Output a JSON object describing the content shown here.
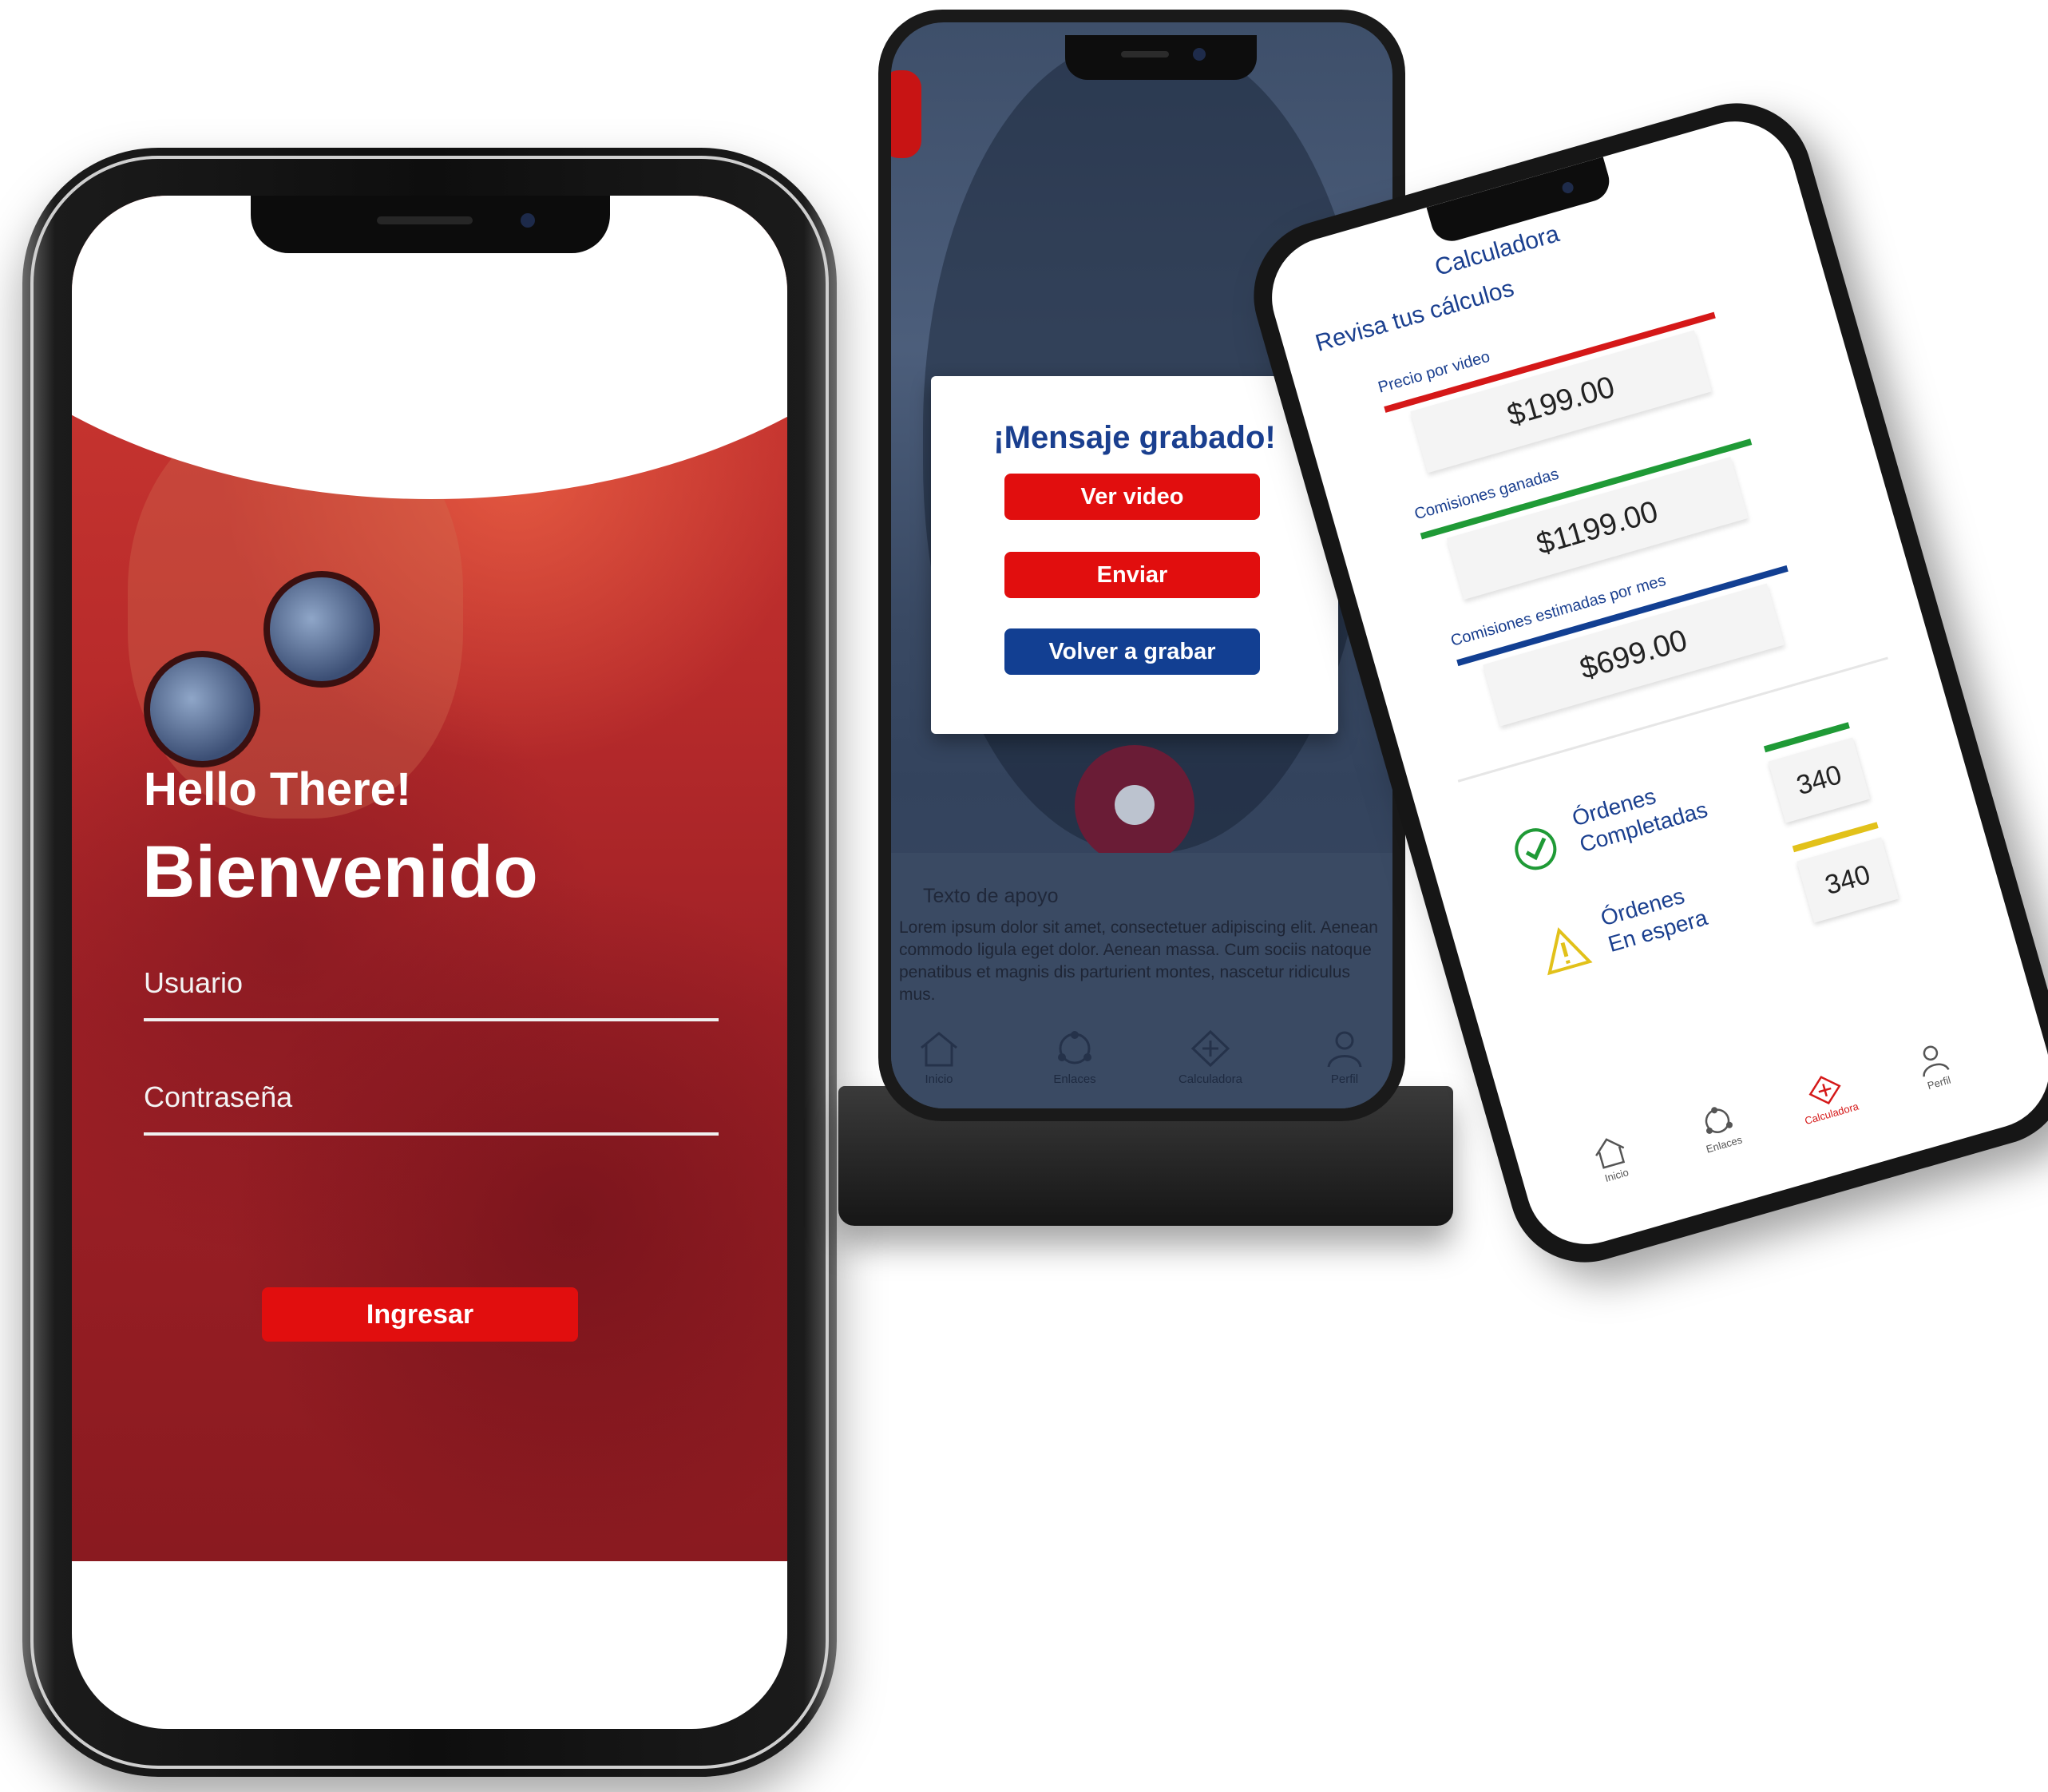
{
  "login": {
    "greeting": "Hello There!",
    "title": "Bienvenido",
    "user_label": "Usuario",
    "password_label": "Contraseña",
    "submit": "Ingresar"
  },
  "video": {
    "modal_title": "¡Mensaje grabado!",
    "btn_view": "Ver video",
    "btn_send": "Enviar",
    "btn_rerecord": "Volver a grabar",
    "support_title": "Texto de apoyo",
    "support_text": "Lorem ipsum dolor sit amet, consectetuer adipiscing elit. Aenean commodo ligula eget dolor. Aenean massa. Cum sociis natoque penatibus et magnis dis parturient montes, nascetur ridiculus mus.",
    "nav": [
      {
        "label": "Inicio",
        "icon": "home-icon"
      },
      {
        "label": "Enlaces",
        "icon": "network-icon"
      },
      {
        "label": "Calculadora",
        "icon": "calculator-icon"
      },
      {
        "label": "Perfil",
        "icon": "user-icon"
      }
    ]
  },
  "calc": {
    "header": "Calculadora",
    "subtitle": "Revisa tus cálculos",
    "cards": [
      {
        "label": "Precio por video",
        "value": "$199.00",
        "color": "#d51818"
      },
      {
        "label": "Comisiones ganadas",
        "value": "$1199.00",
        "color": "#1f9a36"
      },
      {
        "label": "Comisiones estimadas por mes",
        "value": "$699.00",
        "color": "#123f92"
      }
    ],
    "orders": [
      {
        "label_line1": "Órdenes",
        "label_line2": "Completadas",
        "value": "340",
        "color": "#1f9a36",
        "icon": "check-circle-icon"
      },
      {
        "label_line1": "Órdenes",
        "label_line2": "En espera",
        "value": "340",
        "color": "#e2c11a",
        "icon": "warning-icon"
      }
    ],
    "nav": [
      {
        "label": "Inicio",
        "icon": "home-icon"
      },
      {
        "label": "Enlaces",
        "icon": "network-icon"
      },
      {
        "label": "Calculadora",
        "icon": "calculator-icon"
      },
      {
        "label": "Perfil",
        "icon": "user-icon"
      }
    ]
  },
  "colors": {
    "brand_red": "#e10e0e",
    "brand_blue": "#123f92",
    "accent_green": "#1f9a36",
    "accent_yellow": "#e2c11a"
  }
}
